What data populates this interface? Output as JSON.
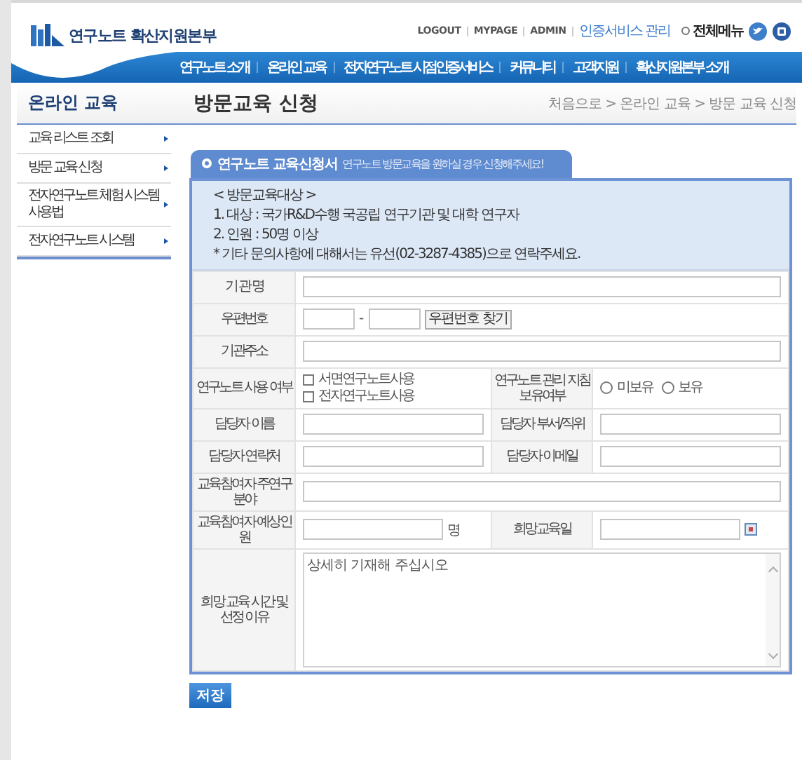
{
  "header": {
    "logo_text": "연구노트 확산지원본부",
    "top_links": [
      {
        "label": "LOGOUT",
        "kind": "plain"
      },
      {
        "label": "MYPAGE",
        "kind": "plain"
      },
      {
        "label": "ADMIN",
        "kind": "plain"
      },
      {
        "label": "인증서비스 관리",
        "kind": "accent"
      },
      {
        "label": "전체메뉴",
        "kind": "menu"
      }
    ],
    "nav": [
      "연구노트 소개",
      "온라인 교육",
      "전자연구노트 시점인증서비스",
      "커뮤니티",
      "고객지원",
      "확산지원본부 소개"
    ]
  },
  "sidebar": {
    "title": "온라인 교육",
    "items": [
      "교육 리스트 조회",
      "방문 교육 신청",
      "전자연구노트 체험 시스템 사용법",
      "전자연구노트 시스템"
    ]
  },
  "page_title": "방문교육 신청",
  "breadcrumb": "처음으로 > 온라인 교육 > 방문 교육 신청",
  "form": {
    "tab_title": "연구노트 교육신청서",
    "tab_hint": "연구노트 방문교육을 원하실 경우 신청해주세요!",
    "notice": [
      "< 방문교육대상 >",
      "1. 대상 : 국가R&D수행 국공립 연구기관 및 대학 연구자",
      "2. 인원 : 50명 이상",
      "* 기타 문의사항에 대해서는 유선(02-3287-4385)으로 연락주세요."
    ],
    "rows": [
      {
        "cells": [
          {
            "label": "기 관 명",
            "kind": "text"
          }
        ]
      },
      {
        "cells": [
          {
            "label": "우편번호",
            "kind": "zip",
            "separator": "-",
            "button": "우편번호 찾기"
          }
        ]
      },
      {
        "cells": [
          {
            "label": "기관주소",
            "kind": "text"
          }
        ]
      },
      {
        "cells": [
          {
            "label": "연구노트 사용 여부",
            "kind": "checkboxes",
            "options": [
              {
                "label": "서면연구노트사용",
                "checked": false
              },
              {
                "label": "전자연구노트사용",
                "checked": false
              }
            ]
          },
          {
            "label": "연구노트 관리 지침 보유여부",
            "kind": "radios",
            "options": [
              {
                "label": "미보유",
                "selected": false
              },
              {
                "label": "보유",
                "selected": false
              }
            ]
          }
        ]
      },
      {
        "cells": [
          {
            "label": "담당자 이름",
            "kind": "text"
          },
          {
            "label": "담당자 부서/직위",
            "kind": "text"
          }
        ]
      },
      {
        "cells": [
          {
            "label": "담당자 연락처",
            "kind": "text"
          },
          {
            "label": "담당자 이메일",
            "kind": "text"
          }
        ]
      },
      {
        "cells": [
          {
            "label": "교육참여자 주연구분야",
            "kind": "text"
          }
        ]
      },
      {
        "cells": [
          {
            "label": "교육참여자 예상인원",
            "kind": "count",
            "unit": "명"
          },
          {
            "label": "희망교육일",
            "kind": "date"
          }
        ]
      },
      {
        "cells": [
          {
            "label": "희망 교육 시간 및 선정 이유",
            "kind": "textarea",
            "value": "상세히 기재해 주십시오"
          }
        ]
      }
    ]
  },
  "save_button": "저장"
}
